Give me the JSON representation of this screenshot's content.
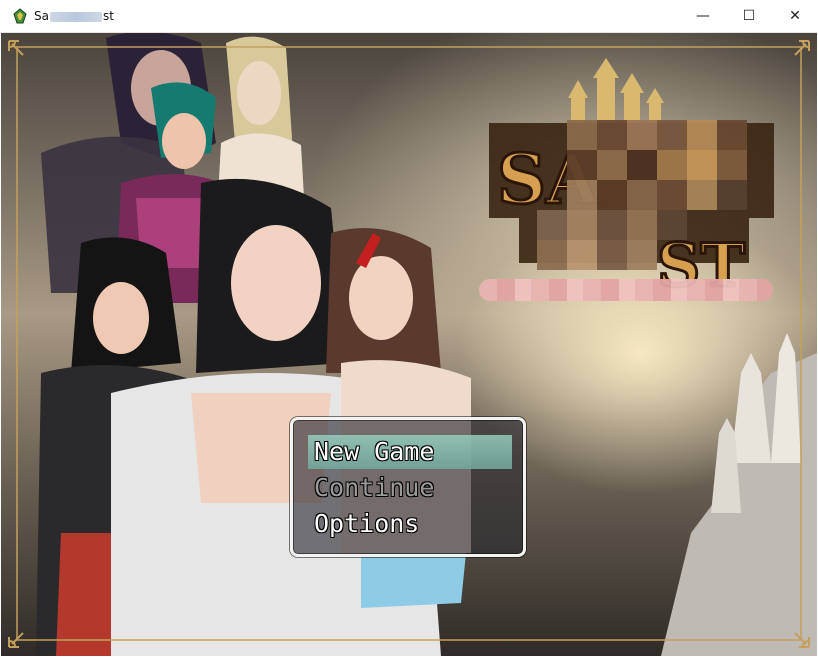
{
  "window": {
    "title_prefix": "Sa",
    "title_suffix": "st",
    "minimize_glyph": "—",
    "maximize_glyph": "☐",
    "close_glyph": "✕"
  },
  "logo": {
    "letters_top": "SA",
    "letters_bottom": "ST"
  },
  "menu": {
    "items": [
      {
        "label": "New Game",
        "state": "selected"
      },
      {
        "label": "Continue",
        "state": "disabled"
      },
      {
        "label": "Options",
        "state": "enabled"
      }
    ]
  },
  "colors": {
    "frame_gold": "#c4a05c",
    "menu_highlight": "#8fc8ba",
    "disabled_text": "#9a9a9a"
  },
  "icons": [
    "app-icon",
    "minimize-icon",
    "maximize-icon",
    "close-icon",
    "corner-ornament-icon"
  ]
}
